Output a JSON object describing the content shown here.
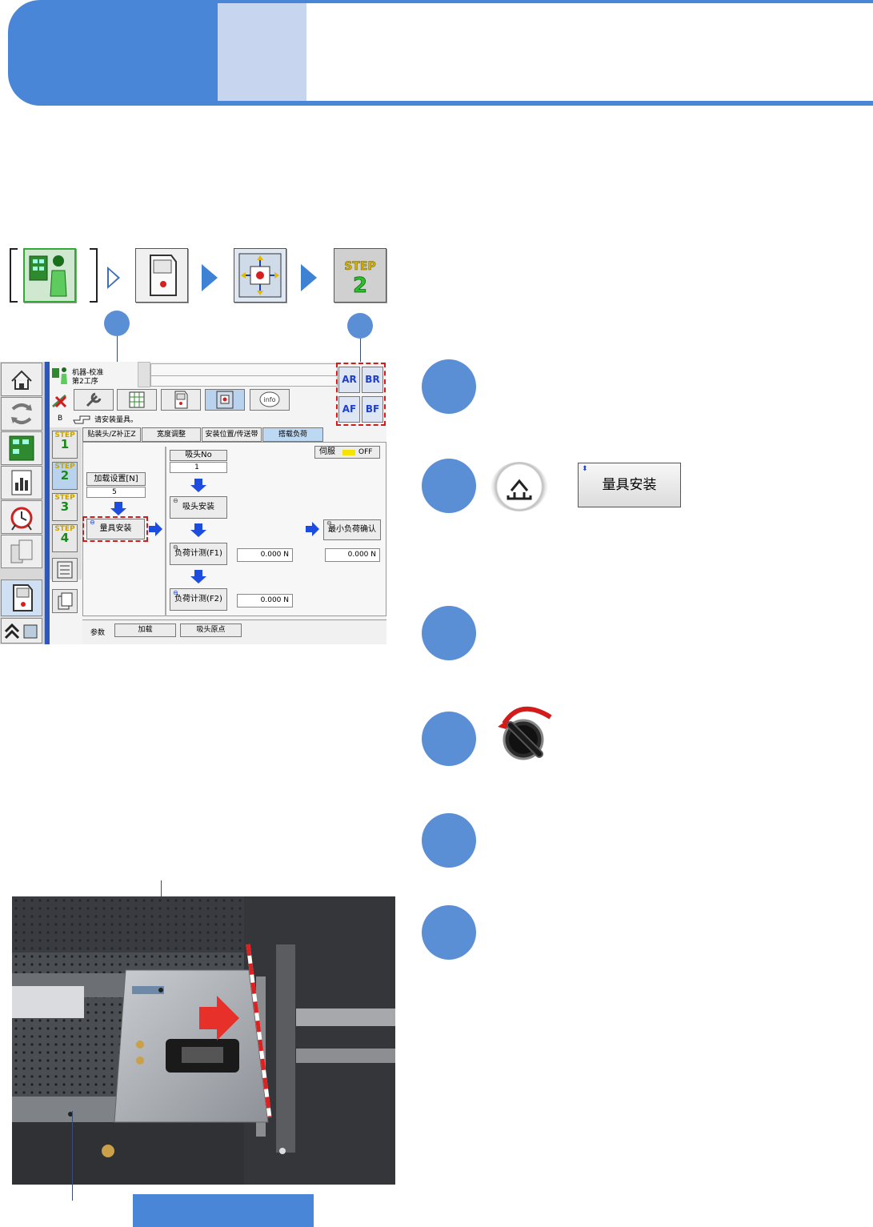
{
  "software": {
    "title_line1": "机器-校准",
    "title_line2": "第2工序",
    "prompt_code": "B",
    "prompt_text": "请安装量具。",
    "tabs": [
      "贴装头/Z补正Z",
      "宽度调整",
      "安装位置/传送带",
      "搭载负荷"
    ],
    "steps": [
      {
        "label": "STEP",
        "num": "1"
      },
      {
        "label": "STEP",
        "num": "2"
      },
      {
        "label": "STEP",
        "num": "3"
      },
      {
        "label": "STEP",
        "num": "4"
      }
    ],
    "load_setting_label": "加载设置[N]",
    "load_setting_value": "5",
    "gauge_install": "量具安装",
    "nozzle_no_label": "吸头No",
    "nozzle_no_value": "1",
    "nozzle_install": "吸头安装",
    "load_measure_f1": "负荷计测(F1)",
    "load_measure_f2": "负荷计测(F2)",
    "min_load_confirm": "最小负荷确认",
    "f1_value": "0.000",
    "f2_value": "0.000",
    "min_value": "0.000",
    "unit": "N",
    "servo_label": "伺服",
    "servo_state": "OFF",
    "params_label": "参数",
    "load_button": "加载",
    "nozzle_origin_button": "吸头原点",
    "head_buttons": [
      "AR",
      "BR",
      "AF",
      "BF"
    ]
  },
  "gauge_button_label": "量具安装",
  "colors": {
    "header_blue": "#4a86d8",
    "header_light": "#c7d6ee",
    "step_circle": "#5a8fd6",
    "highlight_red": "#d21b1b",
    "arrow_blue": "#1d4de0"
  },
  "icons": {
    "flow": [
      "machine-person-icon",
      "machine-door-icon",
      "calibration-target-icon",
      "step-2-icon"
    ],
    "home_key": "home-up-arrow-icon",
    "knob": "rotary-switch-icon"
  }
}
